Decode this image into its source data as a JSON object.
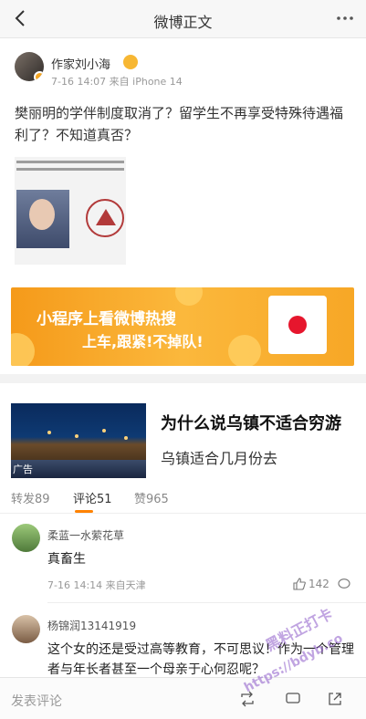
{
  "header": {
    "title": "微博正文"
  },
  "post": {
    "author_name": "作家刘小海",
    "meta": "7-16 14:07 来自 iPhone 14",
    "text": "樊丽明的学伴制度取消了？留学生不再享受特殊待遇福利了？不知道真否？"
  },
  "banner": {
    "line1": "小程序上看微博热搜",
    "line2": "上车,跟紧!不掉队!"
  },
  "ad": {
    "title": "为什么说乌镇不适合穷游",
    "subtitle": "乌镇适合几月份去",
    "mark": "广告"
  },
  "tabs": [
    {
      "label": "转发89"
    },
    {
      "label": "评论51"
    },
    {
      "label": "赞965"
    }
  ],
  "comments": [
    {
      "name": "柔蓝一水萦花草",
      "text": "真畜生",
      "meta": "7-16 14:14 来自天津",
      "likes": "142"
    },
    {
      "name": "杨锦润13141919",
      "text": "这个女的还是受过高等教育，不可思议！作为一个管理者与年长者甚至一个母亲于心何忍呢？"
    }
  ],
  "bottom": {
    "input_placeholder": "发表评论"
  },
  "watermark": {
    "line1": "黑料正打卡",
    "line2": "https://bdyb.co"
  },
  "colors": {
    "accent": "#ff8200",
    "banner": "#f7a726",
    "verified": "#f5a623"
  }
}
